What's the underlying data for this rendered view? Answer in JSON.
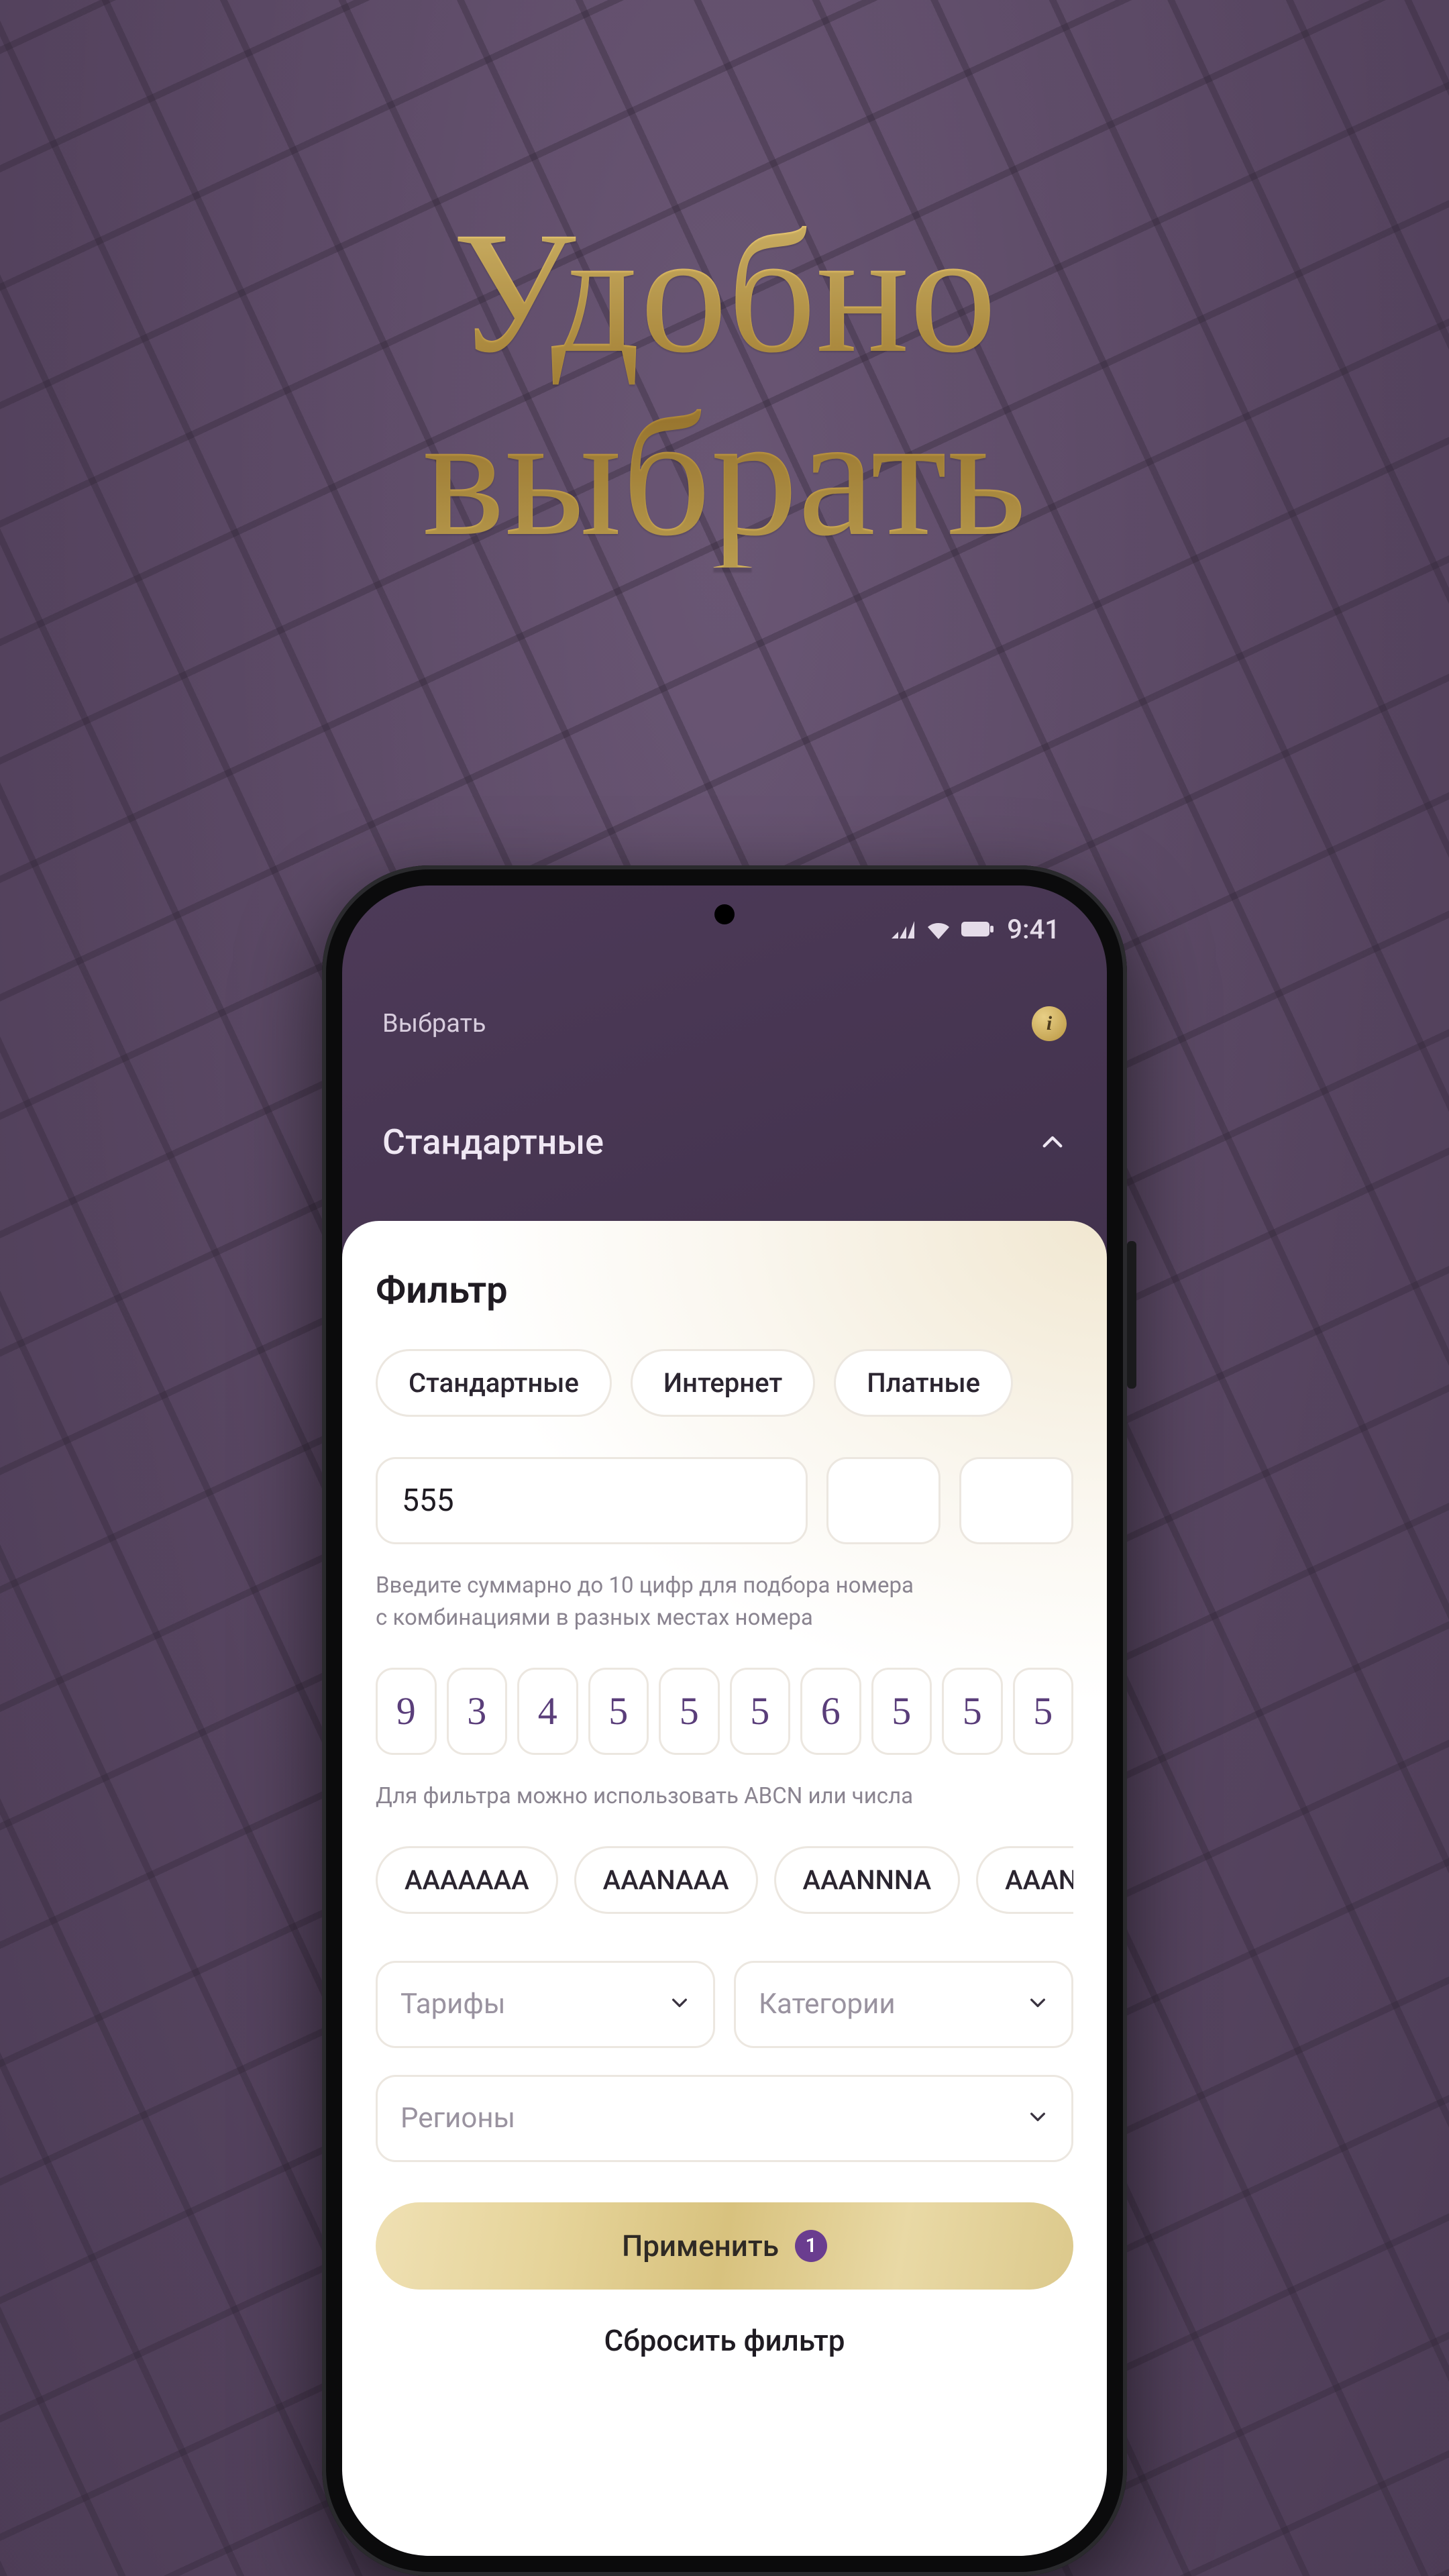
{
  "promo": {
    "line1": "Удобно",
    "line2": "выбрать"
  },
  "status": {
    "time": "9:41"
  },
  "header": {
    "select_label": "Выбрать",
    "category_title": "Стандартные"
  },
  "sheet": {
    "title": "Фильтр",
    "type_chips": [
      "Стандартные",
      "Интернет",
      "Платные"
    ],
    "combo_value": "555",
    "hint": "Введите суммарно до 10 цифр для подбора номера с комбинациями в разных местах номера",
    "digits": [
      "9",
      "3",
      "4",
      "5",
      "5",
      "5",
      "6",
      "5",
      "5",
      "5"
    ],
    "pattern_hint": "Для фильтра можно использовать ABCN или числа",
    "pattern_chips": [
      "AAAAAAA",
      "AAANAAA",
      "AAANNNA",
      "AAAN"
    ],
    "selects": {
      "tariffs_label": "Тарифы",
      "categories_label": "Категории",
      "regions_label": "Регионы"
    },
    "apply_label": "Применить",
    "apply_badge": "1",
    "reset_label": "Сбросить фильтр"
  }
}
